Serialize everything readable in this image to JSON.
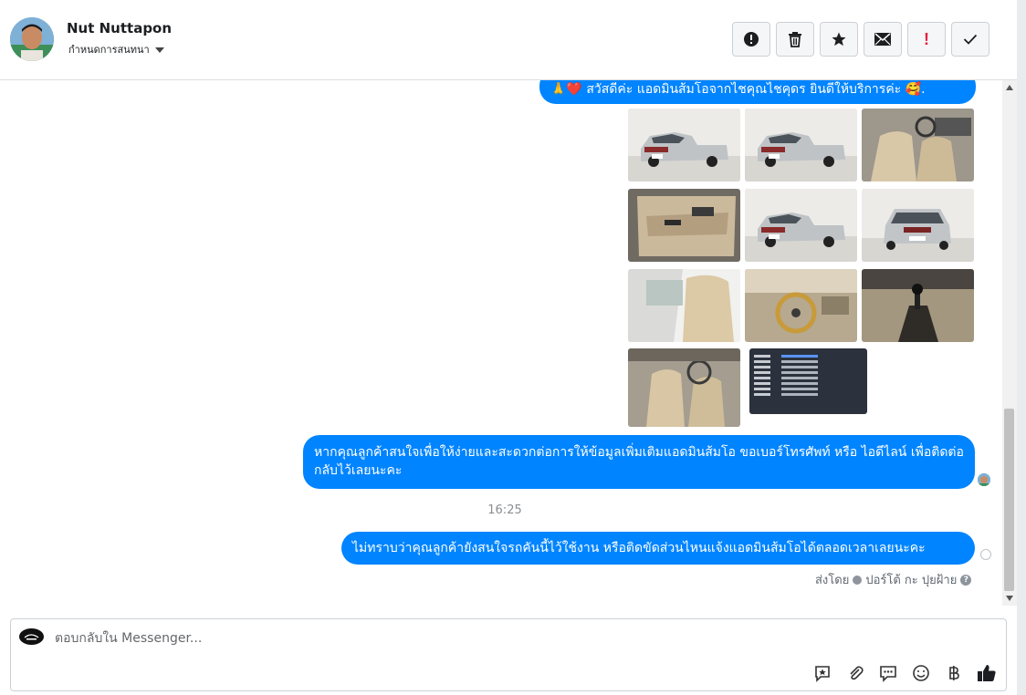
{
  "header": {
    "contact_name": "Nut Nuttapon",
    "subtitle": "กำหนดการสนทนา",
    "tools": [
      {
        "name": "spam-report",
        "icon": "alert-circle-icon"
      },
      {
        "name": "delete",
        "icon": "trash-icon"
      },
      {
        "name": "star",
        "icon": "star-icon"
      },
      {
        "name": "mark-unread",
        "icon": "envelope-icon"
      },
      {
        "name": "important",
        "icon": "exclamation-icon",
        "label": "!"
      },
      {
        "name": "done",
        "icon": "check-icon"
      }
    ]
  },
  "messages": {
    "greeting": "🙏❤️ สวัสดีค่ะ แอดมินส้มโอจากไชคุณไชคุดร ยินดีให้บริการค่ะ 🥰.",
    "contact_request": "หากคุณลูกค้าสนใจเพื่อให้ง่ายและสะดวกต่อการให้ข้อมูลเพิ่มเติมแอดมินส้มโอ ขอเบอร์โทรศัพท์ หรือ ไอดีไลน์ เพื่อติดต่อกลับไว้เลยนะคะ",
    "timestamp": "16:25",
    "followup": "ไม่ทราบว่าคุณลูกค้ายังสนใจรถคันนี้ไว้ใช้งาน หรือติดขัดส่วนไหนแจ้งแอดมินส้มโอได้ตลอดเวลาเลยนะคะ",
    "sent_by_prefix": "ส่งโดย",
    "sent_by_name": "ปอร์โต้ กะ ปุยฝ้าย"
  },
  "photos": [
    {
      "subject": "pickup-front-left"
    },
    {
      "subject": "pickup-front-left"
    },
    {
      "subject": "interior-seats"
    },
    {
      "subject": "door-panel"
    },
    {
      "subject": "pickup-front-left"
    },
    {
      "subject": "pickup-front"
    },
    {
      "subject": "rear-cab-seat"
    },
    {
      "subject": "steering-wheel"
    },
    {
      "subject": "gear-shift"
    },
    {
      "subject": "front-seats"
    },
    {
      "subject": "spec-sheet"
    }
  ],
  "composer": {
    "placeholder": "ตอบกลับใน Messenger..."
  },
  "colors": {
    "bubble": "#0084ff",
    "important": "#e41e3f"
  }
}
